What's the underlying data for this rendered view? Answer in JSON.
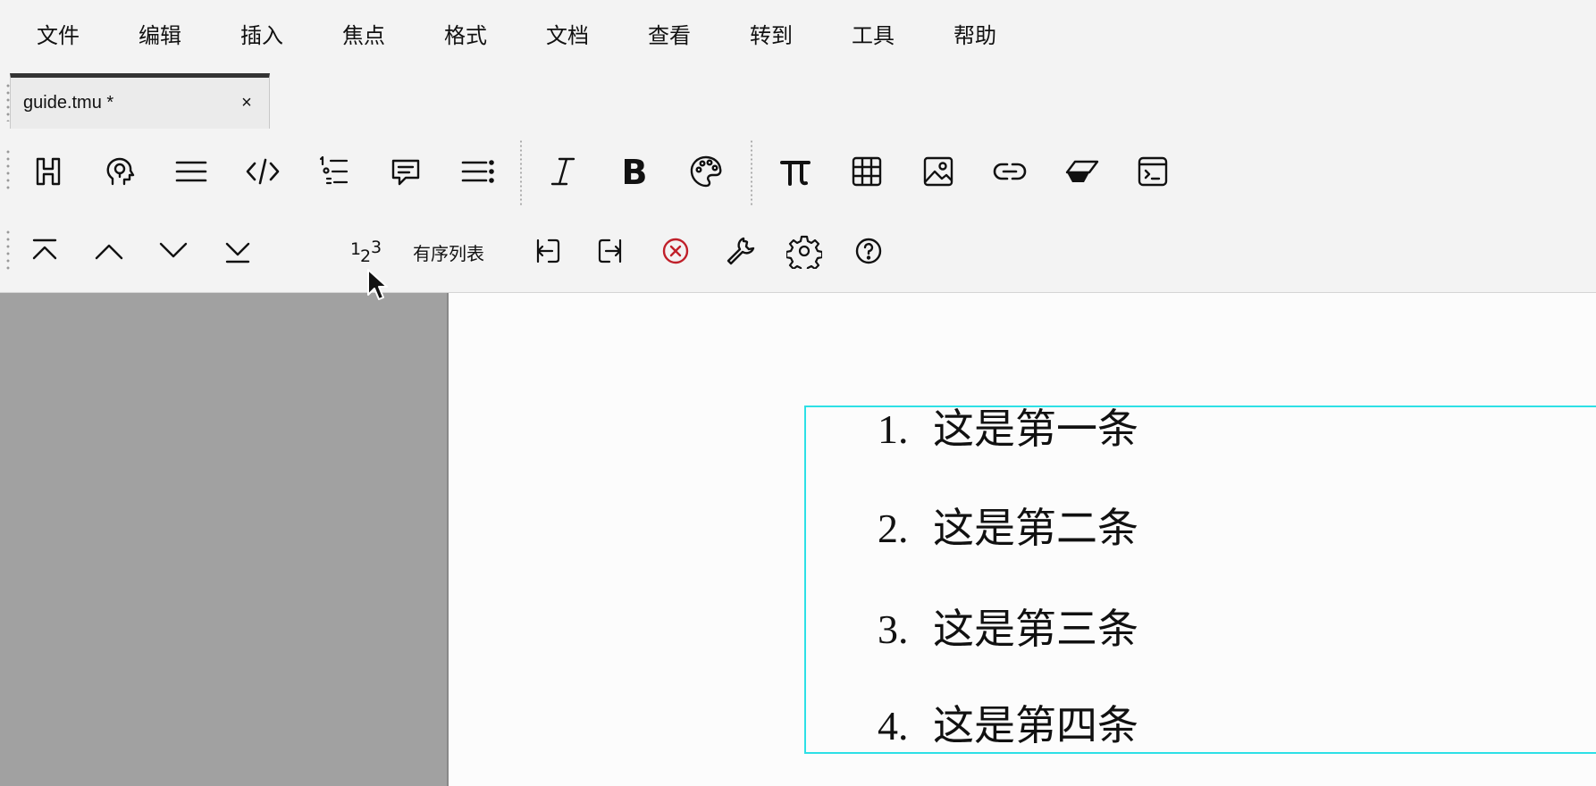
{
  "menubar": {
    "items": [
      "文件",
      "编辑",
      "插入",
      "焦点",
      "格式",
      "文档",
      "查看",
      "转到",
      "工具",
      "帮助"
    ]
  },
  "tab": {
    "title": "guide.tmu *",
    "close": "×"
  },
  "toolbar1": {
    "buttons": [
      "heading-icon",
      "idea-icon",
      "paragraph-icon",
      "code-icon",
      "list-structure-icon",
      "comment-icon",
      "bullet-list-icon",
      "italic-icon",
      "bold-icon",
      "palette-icon",
      "pi-icon",
      "table-icon",
      "image-icon",
      "link-icon",
      "eraser-icon",
      "terminal-icon"
    ]
  },
  "toolbar2": {
    "list_label": "有序列表",
    "buttons": [
      "move-top-icon",
      "move-up-icon",
      "move-down-icon",
      "move-bottom-icon",
      "ordered-number-icon",
      "outdent-icon",
      "indent-icon",
      "delete-icon",
      "wrench-icon",
      "settings-icon",
      "help-icon"
    ]
  },
  "colors": {
    "focus_border": "#2de0e6",
    "delete_icon": "#c0202a",
    "sidebar": "#a1a1a1"
  },
  "document": {
    "list": [
      {
        "num": "1.",
        "text": "这是第一条"
      },
      {
        "num": "2.",
        "text": "这是第二条"
      },
      {
        "num": "3.",
        "text": "这是第三条"
      },
      {
        "num": "4.",
        "text": "这是第四条"
      }
    ]
  }
}
